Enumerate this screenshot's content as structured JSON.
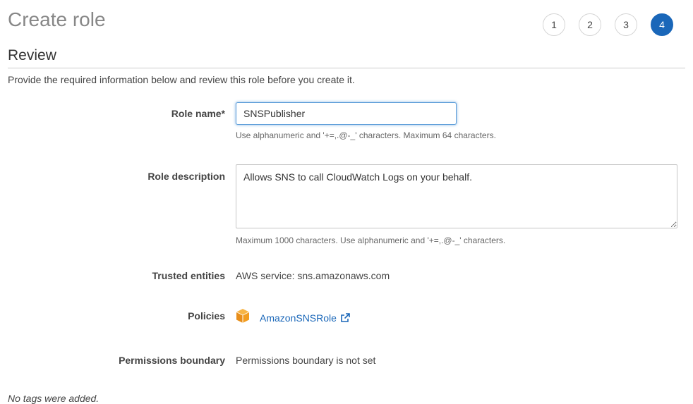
{
  "header": {
    "title": "Create role",
    "steps": [
      "1",
      "2",
      "3",
      "4"
    ],
    "active_step": "4"
  },
  "review": {
    "title": "Review",
    "intro": "Provide the required information below and review this role before you create it."
  },
  "role_name": {
    "label": "Role name*",
    "value": "SNSPublisher",
    "help": "Use alphanumeric and '+=,.@-_' characters. Maximum 64 characters."
  },
  "role_description": {
    "label": "Role description",
    "value": "Allows SNS to call CloudWatch Logs on your behalf.",
    "help": "Maximum 1000 characters. Use alphanumeric and '+=,.@-_' characters."
  },
  "trusted_entities": {
    "label": "Trusted entities",
    "value": "AWS service: sns.amazonaws.com"
  },
  "policies": {
    "label": "Policies",
    "icon": "policy-box-icon",
    "link": "AmazonSNSRole",
    "link_icon": "external-link-icon"
  },
  "permissions_boundary": {
    "label": "Permissions boundary",
    "value": "Permissions boundary is not set"
  },
  "tags": {
    "note": "No tags were added."
  },
  "colors": {
    "accent": "#1a67b9",
    "policy_icon": "#f29d20"
  }
}
